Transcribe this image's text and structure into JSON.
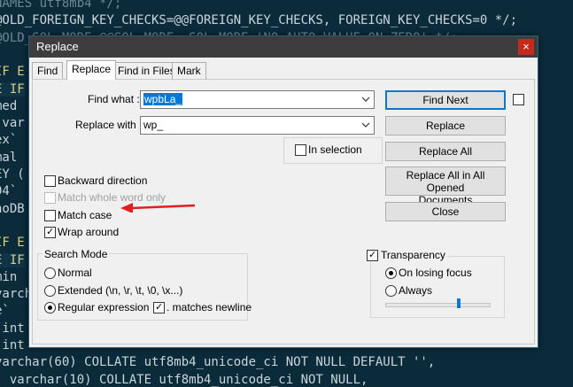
{
  "editor": {
    "lines": [
      {
        "text": "NAMES utf8mb4 */;",
        "cls": "c-dim"
      },
      {
        "text": "@OLD_FOREIGN_KEY_CHECKS=@@FOREIGN_KEY_CHECKS, FOREIGN_KEY_CHECKS=0 */;",
        "cls": "c-kw"
      },
      {
        "text": "@OLD_SQL_MODE=@@SQL_MODE, SQL_MODE='NO_AUTO_VALUE_ON_ZERO' */;",
        "cls": "c-dim"
      },
      {
        "text": "",
        "cls": "c-dim"
      },
      {
        "text": "IF E",
        "cls": "c-yel"
      },
      {
        "text": "E IF",
        "cls": "c-yel"
      },
      {
        "text": "med",
        "cls": "c-kw"
      },
      {
        "text": " var",
        "cls": "c-kw"
      },
      {
        "text": "ex`",
        "cls": "c-kw"
      },
      {
        "text": "mal",
        "cls": "c-kw"
      },
      {
        "text": "EY (",
        "cls": "c-kw"
      },
      {
        "text": "04`",
        "cls": "c-kw"
      },
      {
        "text": "noDB",
        "cls": "c-kw"
      },
      {
        "text": "",
        "cls": "c-dim"
      },
      {
        "text": "IF E",
        "cls": "c-yel"
      },
      {
        "text": "E IF",
        "cls": "c-yel"
      },
      {
        "text": "min",
        "cls": "c-kw"
      },
      {
        "text": "varcha",
        "cls": "c-kw"
      },
      {
        "text": "e`",
        "cls": "c-kw"
      },
      {
        "text": "`int",
        "cls": "c-kw"
      },
      {
        "text": " int",
        "cls": "c-kw"
      },
      {
        "text": "varchar(60) COLLATE utf8mb4_unicode_ci NOT NULL DEFAULT '',",
        "cls": "c-kw"
      },
      {
        "text": "` varchar(10) COLLATE utf8mb4_unicode_ci NOT NULL,",
        "cls": "c-kw"
      }
    ]
  },
  "dialog": {
    "title": "Replace",
    "close": "×",
    "tabs": [
      "Find",
      "Replace",
      "Find in Files",
      "Mark"
    ],
    "find_what_label": "Find what :",
    "find_what_value": "wpbLa_",
    "replace_with_label": "Replace with :",
    "replace_with_value": "wp_",
    "buttons": {
      "find_next": "Find Next",
      "replace": "Replace",
      "replace_all": "Replace All",
      "replace_all_opened_1": "Replace All in All Opened",
      "replace_all_opened_2": "Documents",
      "close": "Close"
    },
    "in_selection": "In selection",
    "options": {
      "backward": "Backward direction",
      "whole_word": "Match whole word only",
      "match_case": "Match case",
      "wrap_around": "Wrap around"
    },
    "search_mode": {
      "title": "Search Mode",
      "normal": "Normal",
      "extended": "Extended (\\n, \\r, \\t, \\0, \\x...)",
      "regex": "Regular expression",
      "matches_newline": ". matches newline",
      "selected": "regex"
    },
    "transparency": {
      "title": "Transparency",
      "on_losing_focus": "On losing focus",
      "always": "Always",
      "level": 0.7
    }
  }
}
